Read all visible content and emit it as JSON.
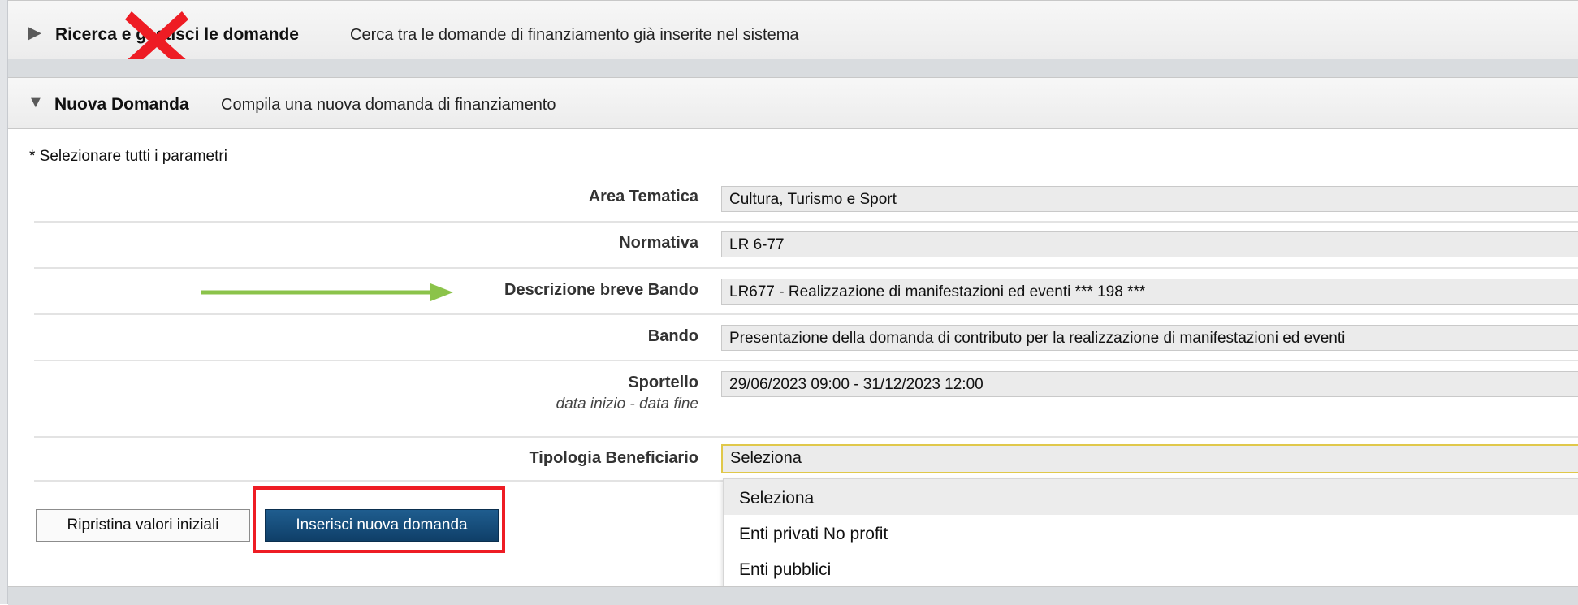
{
  "panel_search": {
    "title": "Ricerca e gestisci le domande",
    "description": "Cerca tra le domande di finanziamento già inserite nel sistema"
  },
  "panel_new": {
    "title": "Nuova Domanda",
    "description": "Compila una nuova domanda di finanziamento"
  },
  "required_note": "* Selezionare tutti i parametri",
  "fields": {
    "area_tematica": {
      "label": "Area Tematica",
      "value": "Cultura, Turismo e Sport"
    },
    "normativa": {
      "label": "Normativa",
      "value": "LR 6-77"
    },
    "descrizione_bando": {
      "label": "Descrizione breve Bando",
      "value": "LR677 - Realizzazione di manifestazioni ed eventi *** 198 ***"
    },
    "bando": {
      "label": "Bando",
      "value": "Presentazione della domanda di contributo per la realizzazione di manifestazioni ed eventi"
    },
    "sportello": {
      "label": "Sportello",
      "sublabel": "data inizio - data fine",
      "value": "29/06/2023 09:00 - 31/12/2023 12:00"
    },
    "tipologia_beneficiario": {
      "label": "Tipologia Beneficiario",
      "value": "Seleziona",
      "options": [
        "Seleziona",
        "Enti privati No profit",
        "Enti pubblici"
      ]
    }
  },
  "buttons": {
    "reset": "Ripristina valori iniziali",
    "insert": "Inserisci nuova domanda"
  },
  "icons": {
    "expand_collapsed": "triangle-right-icon",
    "expand_open": "triangle-down-icon",
    "annotation_arrow": "green-arrow-right",
    "annotation_cross": "red-x-icon"
  },
  "colors": {
    "primary_button": "#1a4f7a",
    "annotation_highlight": "#ee1c24",
    "annotation_arrow": "#8bc34a",
    "annotation_cross": "#ee1c24",
    "active_select_border": "#e0c84a"
  }
}
